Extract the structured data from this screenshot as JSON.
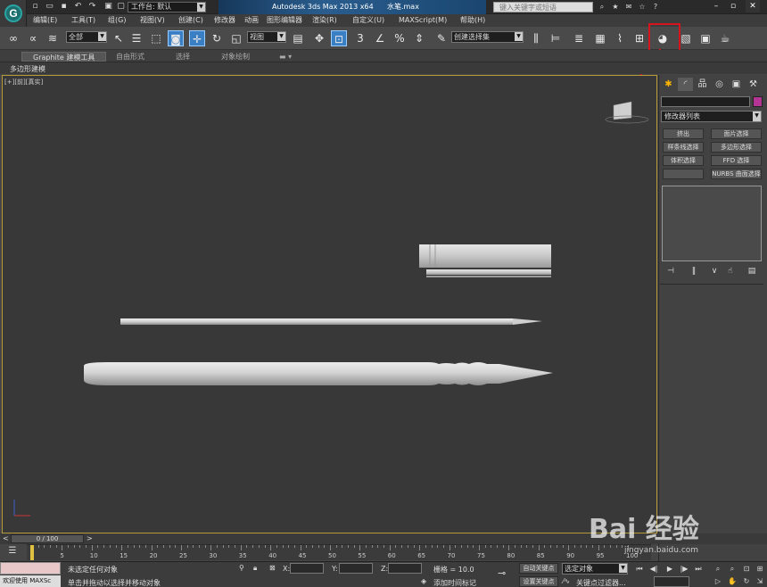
{
  "titlebar": {
    "app_title": "Autodesk 3ds Max  2013 x64",
    "file_name": "水笔.max",
    "workspace": "工作台: 默认",
    "search_placeholder": "键入关键字或短语"
  },
  "menu": [
    "编辑(E)",
    "工具(T)",
    "组(G)",
    "视图(V)",
    "创建(C)",
    "修改器",
    "动画",
    "图形编辑器",
    "渲染(R)",
    "自定义(U)",
    "MAXScript(M)",
    "帮助(H)"
  ],
  "toolbar": {
    "selection_filter": "全部",
    "reference_coord": "视图",
    "named_selection": "创建选择集",
    "snap_label": "3"
  },
  "ribbon": {
    "tabs": [
      "Graphite 建模工具",
      "自由形式",
      "选择",
      "对象绘制"
    ],
    "sub_label": "多边形建模"
  },
  "viewport": {
    "label": "[+][前][真实]"
  },
  "command_panel": {
    "modifier_list": "修改器列表",
    "buttons": [
      "挤出",
      "面片选择",
      "样条线选择",
      "多边形选择",
      "体积选择",
      "FFD 选择",
      "",
      "NURBS 曲面选择"
    ],
    "swatch_color": "#b53595"
  },
  "timeline": {
    "frame": "0 / 100",
    "ticks": [
      "0",
      "5",
      "10",
      "15",
      "20",
      "25",
      "30",
      "35",
      "40",
      "45",
      "50",
      "55",
      "60",
      "65",
      "70",
      "75",
      "80",
      "85",
      "90",
      "95",
      "100"
    ]
  },
  "status": {
    "welcome": "欢迎使用 MAXSc",
    "selection_msg": "未选定任何对象",
    "prompt_msg": "单击并拖动以选择并移动对象",
    "x_label": "X:",
    "y_label": "Y:",
    "z_label": "Z:",
    "grid": "栅格 = 10.0",
    "add_time_tag": "添加时间标记",
    "auto_key": "自动关键点",
    "set_key": "设置关键点",
    "selected_object": "选定对象",
    "key_filter": "关键点过滤器..."
  },
  "watermark": {
    "brand": "Bai 经验",
    "url": "jingyan.baidu.com"
  },
  "colors": {
    "annotation": "#d4151d",
    "viewport_border": "#b59b3c"
  }
}
